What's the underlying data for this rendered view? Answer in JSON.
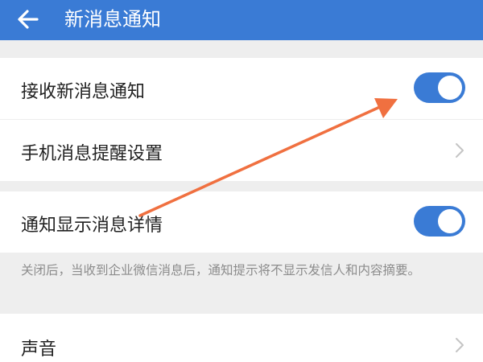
{
  "header": {
    "title": "新消息通知",
    "back_icon": "arrow-left-icon"
  },
  "settings": {
    "receive_notifications": {
      "label": "接收新消息通知",
      "enabled": true
    },
    "phone_reminder": {
      "label": "手机消息提醒设置"
    },
    "show_details": {
      "label": "通知显示消息详情",
      "enabled": true
    },
    "details_description": "关闭后，当收到企业微信消息后，通知提示将不显示发信人和内容摘要。",
    "sound": {
      "label": "声音"
    }
  },
  "colors": {
    "accent": "#3a7bd5",
    "annotation": "#f07040",
    "background": "#eeeeee"
  }
}
